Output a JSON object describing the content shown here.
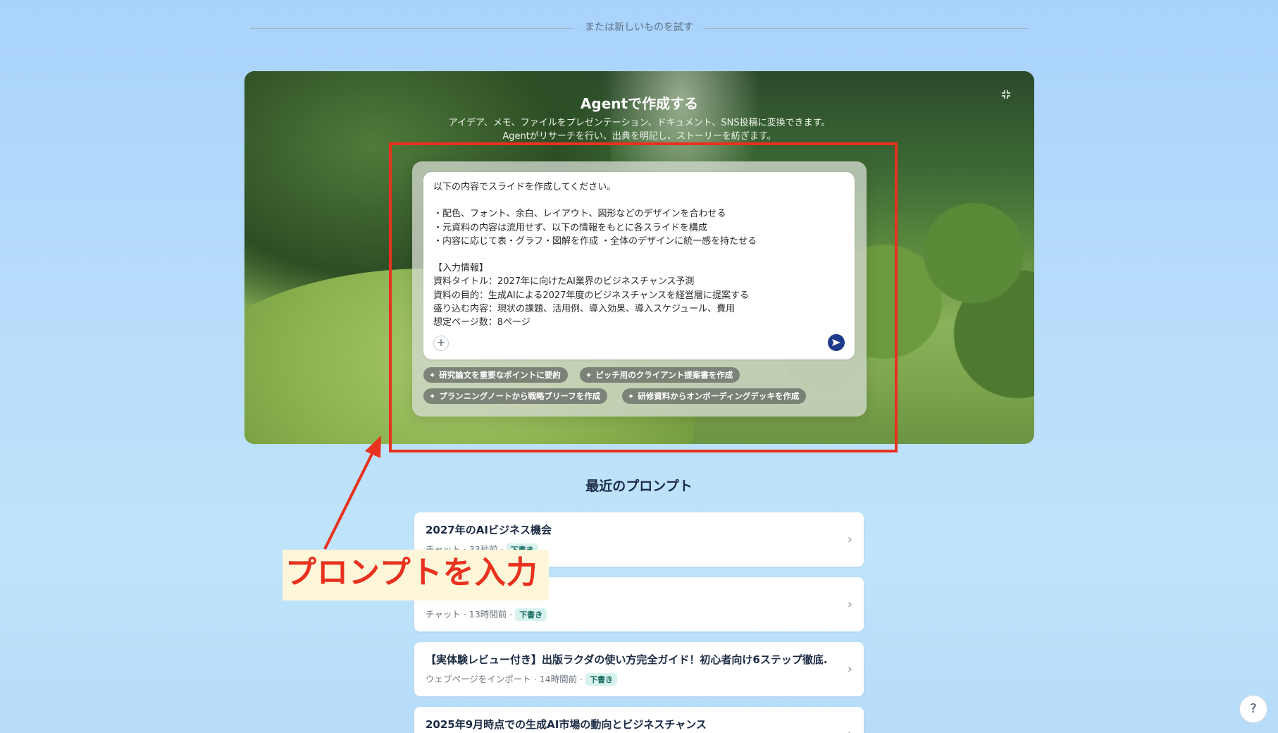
{
  "divider": {
    "text": "または新しいものを試す"
  },
  "hero": {
    "title": "Agentで作成する",
    "subtitle_line1": "アイデア、メモ、ファイルをプレゼンテーション、ドキュメント、SNS投稿に変換できます。",
    "subtitle_line2": "Agentがリサーチを行い、出典を明記し、ストーリーを紡ぎます。",
    "collapse_icon": "collapse-icon"
  },
  "prompt": {
    "text": "以下の内容でスライドを作成してください。\n\n・配色、フォント、余白、レイアウト、図形などのデザインを合わせる\n・元資料の内容は流用せず、以下の情報をもとに各スライドを構成\n・内容に応じて表・グラフ・図解を作成 ・全体のデザインに統一感を持たせる\n\n【入力情報】\n資料タイトル：2027年に向けたAI業界のビジネスチャンス予測\n資料の目的：生成AIによる2027年度のビジネスチャンスを経営層に提案する\n盛り込む内容：現状の課題、活用例、導入効果、導入スケジュール、費用\n想定ページ数：8ページ",
    "plus_label": "+",
    "send_icon": "send-icon"
  },
  "suggestions": [
    {
      "label": "研究論文を重要なポイントに要約"
    },
    {
      "label": "ピッチ用のクライアント提案書を作成"
    },
    {
      "label": "プランニングノートから戦略ブリーフを作成"
    },
    {
      "label": "研修資料からオンボーディングデッキを作成"
    }
  ],
  "annotation": {
    "label": "プロンプトを入力",
    "color": "#e8311e"
  },
  "recent": {
    "title": "最近のプロンプト",
    "items": [
      {
        "title": "2027年のAIビジネス機会",
        "meta": "チャット · 33秒前 ·",
        "badge": "下書き"
      },
      {
        "title": "",
        "meta": "チャット · 13時間前 ·",
        "badge": "下書き"
      },
      {
        "title": "【実体験レビュー付き】出版ラクダの使い方完全ガイド！初心者向け6ステップ徹底...",
        "meta": "ウェブページをインポート · 14時間前 ·",
        "badge": "下書き"
      },
      {
        "title": "2025年9月時点での生成AI市場の動向とビジネスチャンス",
        "meta": "",
        "badge": ""
      }
    ]
  },
  "help": {
    "label": "?"
  }
}
